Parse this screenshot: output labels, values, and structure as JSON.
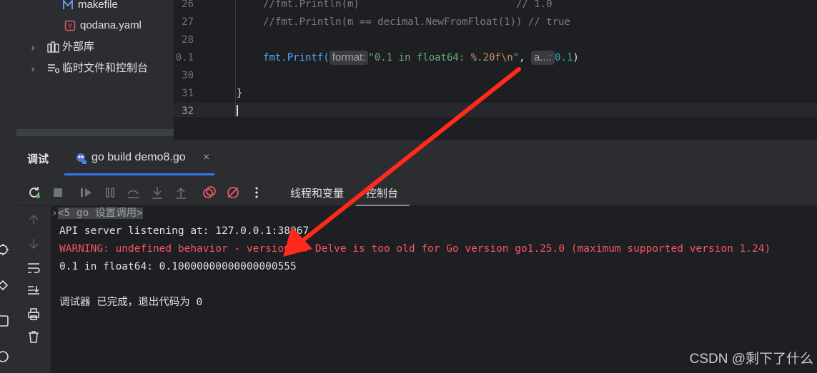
{
  "tree": {
    "items": [
      {
        "label": "makefile",
        "icon": "makefile-icon"
      },
      {
        "label": "qodana.yaml",
        "icon": "yaml-icon"
      },
      {
        "label": "外部库",
        "icon": "library-icon"
      },
      {
        "label": "临时文件和控制台",
        "icon": "scratches-icon"
      }
    ]
  },
  "editor": {
    "lines": [
      {
        "num": "26",
        "text": "//fmt.Println(m)                          // 1.0"
      },
      {
        "num": "27",
        "text": "//fmt.Println(m == decimal.NewFromFloat(1)) // true"
      },
      {
        "num": "28",
        "text": ""
      },
      {
        "num": "0.1",
        "fn": "fmt.Printf(",
        "hint1": "format:",
        "str": "\"0.1 in float64: ",
        "fmt": "%.20f\\n",
        "strend": "\"",
        "comma": ",",
        "hint2": "a...:",
        "close": ")"
      },
      {
        "num": "30",
        "text": ""
      },
      {
        "num": "31",
        "text": "}"
      },
      {
        "num": "32",
        "text": ""
      }
    ]
  },
  "debug": {
    "title": "调试",
    "session": "go build demo8.go",
    "close": "×",
    "tabs": {
      "threads": "线程和变量",
      "console": "控制台"
    },
    "console": {
      "frames": "<5 go 设置调用>",
      "line1": "API server listening at: 127.0.0.1:38967",
      "warning": "WARNING: undefined behavior - version of Delve is too old for Go version go1.25.0 (maximum supported version 1.24)",
      "output": "0.1 in float64: 0.10000000000000000555",
      "exit": "调试器 已完成，退出代码为 0"
    }
  },
  "watermark": "CSDN @剩下了什么",
  "colors": {
    "annotation_arrow": "#ff2a1a",
    "accent": "#3574f0",
    "warning": "#f75464"
  }
}
